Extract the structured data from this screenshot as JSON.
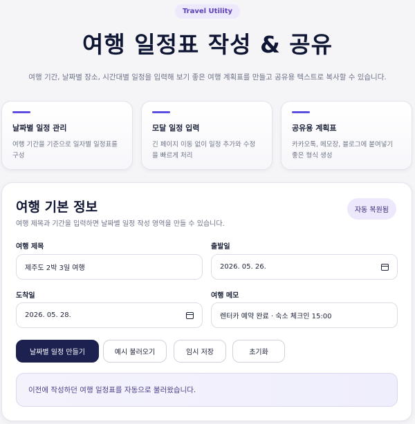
{
  "hero": {
    "pill": "Travel Utility",
    "title": "여행 일정표 작성 & 공유",
    "subtitle": "여행 기간, 날짜별 장소, 시간대별 일정을 입력해 보기 좋은 여행 계획표를 만들고 공유용 텍스트로 복사할 수 있습니다."
  },
  "features": [
    {
      "title": "날짜별 일정 관리",
      "desc_line1": "여행 기간을 기준으로 일자별 일정표를",
      "desc_line2": "구성"
    },
    {
      "title": "모달 일정 입력",
      "desc_line1": "긴 페이지 이동 없이 일정 추가와 수정",
      "desc_line2": "을 빠르게 처리"
    },
    {
      "title": "공유용 계획표",
      "desc_line1": "카카오톡, 메모장, 블로그에 붙여넣기",
      "desc_line2": "좋은 형식 생성"
    }
  ],
  "card": {
    "title": "여행 기본 정보",
    "desc": "여행 제목과 기간을 입력하면 날짜별 일정 작성 영역을 만들 수 있습니다.",
    "badge": "자동 복원됨",
    "fields": {
      "trip_title_label": "여행 제목",
      "trip_title_value": "제주도 2박 3일 여행",
      "departure_label": "출발일",
      "departure_value": "2026. 05. 26.",
      "arrival_label": "도착일",
      "arrival_value": "2026. 05. 28.",
      "memo_label": "여행 메모",
      "memo_value": "렌터카 예약 완료 · 숙소 체크인 15:00"
    },
    "buttons": {
      "make_days": "날짜별 일정 만들기",
      "load_example": "예시 불러오기",
      "temp_save": "임시 저장",
      "reset": "초기화"
    },
    "notice": "이전에 작성하던 여행 일정표를 자동으로 불러왔습니다."
  },
  "colors": {
    "accent": "#5b4ee0",
    "primary_button": "#1c2150",
    "pill_bg": "#ede8fb"
  }
}
